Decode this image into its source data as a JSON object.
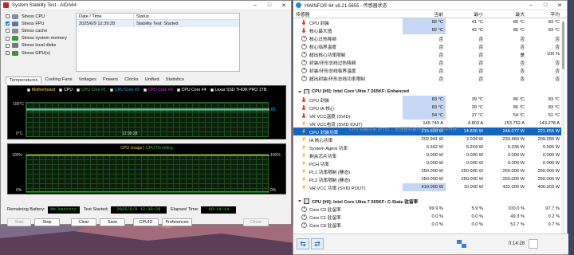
{
  "aida": {
    "title": "System Stability Test - AIDA64",
    "stress_items": [
      {
        "label": "Stress CPU",
        "checked": false,
        "icon": "cpu-icon",
        "color": "#7d8fa8"
      },
      {
        "label": "Stress FPU",
        "checked": true,
        "icon": "fpu-icon",
        "color": "#5a76a8"
      },
      {
        "label": "Stress cache",
        "checked": false,
        "icon": "cache-icon",
        "color": "#8a8a8a"
      },
      {
        "label": "Stress system memory",
        "checked": false,
        "icon": "memory-icon",
        "color": "#3a9a3a"
      },
      {
        "label": "Stress local disks",
        "checked": false,
        "icon": "disk-icon",
        "color": "#777777"
      },
      {
        "label": "Stress GPU(s)",
        "checked": false,
        "icon": "gpu-icon",
        "color": "#4a8a4a"
      }
    ],
    "status_table": {
      "col_date": "Date / Time",
      "col_status": "Status",
      "row": {
        "date": "2025/6/9 12:39:28",
        "status": "Stability Test: Started"
      }
    },
    "tabs": [
      "Temperatures",
      "Cooling Fans",
      "Voltages",
      "Powers",
      "Clocks",
      "Unified",
      "Statistics"
    ],
    "graph1": {
      "legend": [
        {
          "label": "Motherboard",
          "color": "#ffd54f"
        },
        {
          "label": "CPU",
          "color": "#ffffff"
        },
        {
          "label": "CPU Core #1",
          "color": "#39c539"
        },
        {
          "label": "CPU Core #2",
          "color": "#29b6f6"
        },
        {
          "label": "CPU Core #3",
          "color": "#e040fb"
        },
        {
          "label": "CPU Core #4",
          "color": "#ffffff"
        },
        {
          "label": "Lexar SSD THOR PRO 1TB",
          "color": "#ffffff"
        }
      ],
      "y_top": "100°C",
      "y_bottom": "0°C",
      "right_value": "83",
      "time_label": "12:39:28"
    },
    "graph2": {
      "title_a": "CPU Usage",
      "separator": " | ",
      "title_b": "CPU Throttling",
      "title_a_color": "#ffd54f",
      "title_b_color": "#39c539",
      "left_top": "100%",
      "left_bottom": "0%",
      "right_top": "100%",
      "right_bottom": "0%"
    },
    "info": {
      "battery_label": "Remaining Battery:",
      "battery_value": "No battery",
      "started_label": "Test Started:",
      "started_value": "2025/6/9 12:39:28",
      "elapsed_label": "Elapsed Time:",
      "elapsed_value": "00:14:14"
    },
    "buttons": {
      "start": "Start",
      "stop": "Stop",
      "clear": "Clear",
      "save": "Save",
      "cpuid": "CPUID",
      "preferences": "Preferences",
      "close": "Close"
    }
  },
  "hwinfo": {
    "title": "HWiNFO® 64 v8.21-5655 - 传感器状态",
    "headers": {
      "name": "传感器",
      "current": "当前",
      "min": "最小",
      "max": "最大",
      "avg": "平均"
    },
    "rows": [
      {
        "type": "data",
        "icon": "thermometer-icon",
        "name": "CPU 封装",
        "cur": "82 °C",
        "min": "41 °C",
        "max": "86 °C",
        "avg": "83 °C",
        "hl": true
      },
      {
        "type": "data",
        "icon": "thermometer-icon",
        "name": "核心最大值",
        "cur": "82 °C",
        "min": "42 °C",
        "max": "86 °C",
        "avg": "83 °C",
        "hl": true
      },
      {
        "type": "data",
        "icon": "clock-icon",
        "name": "核心过热降频",
        "cur": "否",
        "min": "否",
        "max": "否",
        "avg": "否",
        "hl": false
      },
      {
        "type": "data",
        "icon": "clock-icon",
        "name": "核心临界温度",
        "cur": "否",
        "min": "否",
        "max": "否",
        "avg": "否",
        "hl": false
      },
      {
        "type": "data",
        "icon": "clock-icon",
        "name": "超出核心功率限制",
        "cur": "否",
        "min": "否",
        "max": "是",
        "avg": "100 %",
        "hl": false
      },
      {
        "type": "data",
        "icon": "clock-icon",
        "name": "封装/环形总线过热降频",
        "cur": "否",
        "min": "否",
        "max": "否",
        "avg": "否",
        "hl": false
      },
      {
        "type": "data",
        "icon": "clock-icon",
        "name": "封装/环形总线临界温度",
        "cur": "否",
        "min": "否",
        "max": "否",
        "avg": "否",
        "hl": false
      },
      {
        "type": "data",
        "icon": "clock-icon",
        "name": "超出封装/环形总线功率限制",
        "cur": "否",
        "min": "否",
        "max": "否",
        "avg": "否",
        "hl": false
      },
      {
        "type": "blank"
      },
      {
        "type": "section",
        "name": "CPU [#0]: Intel Core Ultra 7 265KF: Enhanced"
      },
      {
        "type": "data",
        "icon": "thermometer-icon",
        "name": "CPU 封装",
        "cur": "83 °C",
        "min": "39 °C",
        "max": "86 °C",
        "avg": "83 °C",
        "hl": true
      },
      {
        "type": "data",
        "icon": "thermometer-icon",
        "name": "CPU IA 核心",
        "cur": "83 °C",
        "min": "39 °C",
        "max": "86 °C",
        "avg": "83 °C",
        "hl": true
      },
      {
        "type": "data",
        "icon": "thermometer-icon",
        "name": "VR VCC温度 (SVID)",
        "cur": "54 °C",
        "min": "37 °C",
        "max": "54 °C",
        "avg": "51 °C",
        "hl": true
      },
      {
        "type": "data",
        "icon": "bolt-icon",
        "name": "VR VCC电流 (SVID IOUT)",
        "cur": "145.749 A",
        "min": "4.803 A",
        "max": "153.752 A",
        "avg": "143.278 A",
        "hl": false
      },
      {
        "type": "data",
        "icon": "bolt-icon",
        "name": "CPU 封装功率",
        "cur": "215.529 W",
        "min": "14.836 W",
        "max": "246.077 W",
        "avg": "221.855 W",
        "hl": true,
        "sel": true
      },
      {
        "type": "data",
        "icon": "bolt-icon",
        "name": "IA 核心功率",
        "cur": "202.941 W",
        "min": "2.034 W",
        "max": "233.466 W",
        "avg": "209.289 W",
        "hl": false
      },
      {
        "type": "data",
        "icon": "bolt-icon",
        "name": "System Agent 功率",
        "cur": "5.562 W",
        "min": "5.264 W",
        "max": "6.336 W",
        "avg": "5.595 W",
        "hl": false
      },
      {
        "type": "data",
        "icon": "bolt-icon",
        "name": "剩余芯片功率",
        "cur": "0.000 W",
        "min": "0.000 W",
        "max": "0.000 W",
        "avg": "0.000 W",
        "hl": false
      },
      {
        "type": "data",
        "icon": "bolt-icon",
        "name": "PCH 功率",
        "cur": "0.000 W",
        "min": "0.000 W",
        "max": "0.000 W",
        "avg": "0.000 W",
        "hl": false
      },
      {
        "type": "data",
        "icon": "bolt-icon",
        "name": "PL1 功率限制 (静态)",
        "cur": "250.000 W",
        "min": "250.000 W",
        "max": "250.000 W",
        "avg": "250.000 W",
        "hl": false
      },
      {
        "type": "data",
        "icon": "bolt-icon",
        "name": "PL2 功率限制 (静态)",
        "cur": "250.000 W",
        "min": "250.000 W",
        "max": "250.000 W",
        "avg": "250.000 W",
        "hl": false
      },
      {
        "type": "data",
        "icon": "bolt-icon",
        "name": "VR VCC 功率 (SVID POUT)",
        "cur": "410.000 W",
        "min": "10.000 W",
        "max": "432.000 W",
        "avg": "406.303 W",
        "hl": true
      },
      {
        "type": "blank"
      },
      {
        "type": "section",
        "name": "CPU [#0]: Intel Core Ultra 7 265KF: C-State 驻留率"
      },
      {
        "type": "data",
        "icon": "clock-icon",
        "name": "Core C0 驻留率",
        "cur": "99.9 %",
        "min": "5.9 %",
        "max": "100.0 %",
        "avg": "97.7 %",
        "hl": false
      },
      {
        "type": "data",
        "icon": "clock-icon",
        "name": "Core C1 驻留率",
        "cur": "0.0 %",
        "min": "0.0 %",
        "max": "49.3 %",
        "avg": "0.2 %",
        "hl": false
      },
      {
        "type": "data",
        "icon": "clock-icon",
        "name": "Core C6 驻留率",
        "cur": "0.0 %",
        "min": "0.0 %",
        "max": "51.7 %",
        "avg": "0.7 %",
        "hl": false
      }
    ],
    "overlay": "CPU 封装功率 (PTS) ... 处理器封装功率 ... 硬件程序内存 ...",
    "status": {
      "time": "0:14:28"
    }
  }
}
